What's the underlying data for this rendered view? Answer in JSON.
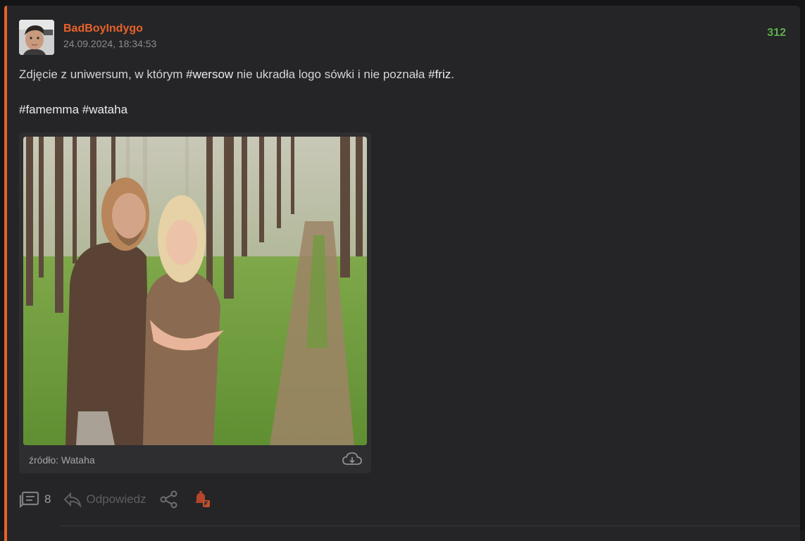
{
  "post": {
    "author": "BadBoyIndygo",
    "timestamp": "24.09.2024, 18:34:53",
    "votes": "312",
    "text_before_tag1": "Zdjęcie z uniwersum, w którym ",
    "tag1": "#wersow",
    "text_between": " nie ukradła logo sówki i nie poznała ",
    "tag2": "#friz",
    "text_after": ".",
    "tag3": "#famemma",
    "tag4": "#wataha"
  },
  "media": {
    "source_label": "źródło: Wataha"
  },
  "actions": {
    "comments_count": "8",
    "reply_label": "Odpowiedz"
  },
  "colors": {
    "accent": "#e8622a",
    "votes": "#5fae4c",
    "background": "#252527"
  },
  "icons": {
    "comments": "comments-icon",
    "reply": "reply-icon",
    "share": "share-icon",
    "notification": "bell-icon",
    "download": "cloud-download-icon"
  }
}
